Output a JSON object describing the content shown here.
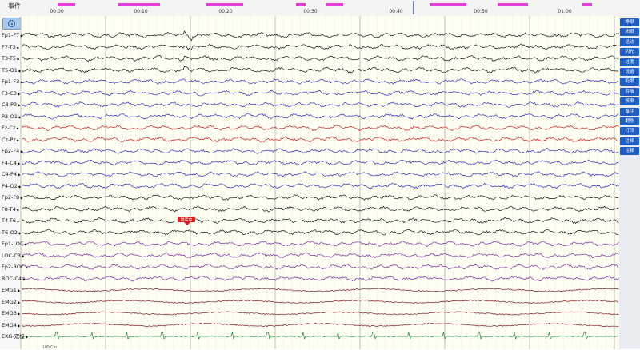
{
  "header": {
    "event_label": "事件",
    "time_ticks": [
      "00:00",
      "00:10",
      "00:20",
      "00:30",
      "00:40",
      "00:50",
      "01:00"
    ],
    "event_color": "#e040d8"
  },
  "channels": [
    {
      "label": "Fp1-F7",
      "color": "#111111"
    },
    {
      "label": "F7-T3",
      "color": "#111111"
    },
    {
      "label": "T3-T5",
      "color": "#111111"
    },
    {
      "label": "T5-O1",
      "color": "#111111"
    },
    {
      "label": "Fp1-F3",
      "color": "#2b2bbd"
    },
    {
      "label": "F3-C3",
      "color": "#2b2bbd"
    },
    {
      "label": "C3-P3",
      "color": "#2b2bbd"
    },
    {
      "label": "P3-O1",
      "color": "#2b2bbd"
    },
    {
      "label": "Fz-Cz",
      "color": "#c82020"
    },
    {
      "label": "Cz-Pz",
      "color": "#c82020"
    },
    {
      "label": "Fp2-F4",
      "color": "#2b2bbd"
    },
    {
      "label": "F4-C4",
      "color": "#2b2bbd"
    },
    {
      "label": "C4-P4",
      "color": "#2b2bbd"
    },
    {
      "label": "P4-O2",
      "color": "#2b2bbd"
    },
    {
      "label": "Fp2-F8",
      "color": "#111111"
    },
    {
      "label": "F8-T4",
      "color": "#111111"
    },
    {
      "label": "T4-T6",
      "color": "#111111"
    },
    {
      "label": "T6-O2",
      "color": "#111111"
    },
    {
      "label": "Fp1-LOC",
      "color": "#7a2a9e"
    },
    {
      "label": "LOC-C3",
      "color": "#7a2a9e"
    },
    {
      "label": "Fp2-ROC",
      "color": "#7a2a9e"
    },
    {
      "label": "ROC-C4",
      "color": "#7a2a9e"
    },
    {
      "label": "EMG1",
      "color": "#7a1a1a"
    },
    {
      "label": "EMG2",
      "color": "#7a1a1a"
    },
    {
      "label": "EMG3",
      "color": "#7a1a1a"
    },
    {
      "label": "EMG4",
      "color": "#7a1a1a"
    },
    {
      "label": "EKG-双极",
      "color": "#1a8a3a"
    }
  ],
  "side_buttons": [
    "睁眼",
    "闭眼",
    "运动",
    "闪光",
    "过度",
    "说话",
    "眨眼",
    "吞咽",
    "咳嗽",
    "备注",
    "翻身",
    "打印",
    "注释",
    "注释"
  ],
  "colors": {
    "button": "#1f5fc4",
    "marker": "#d82020"
  },
  "marker_text": "说话中",
  "bottom_text": "0.05 Cm"
}
